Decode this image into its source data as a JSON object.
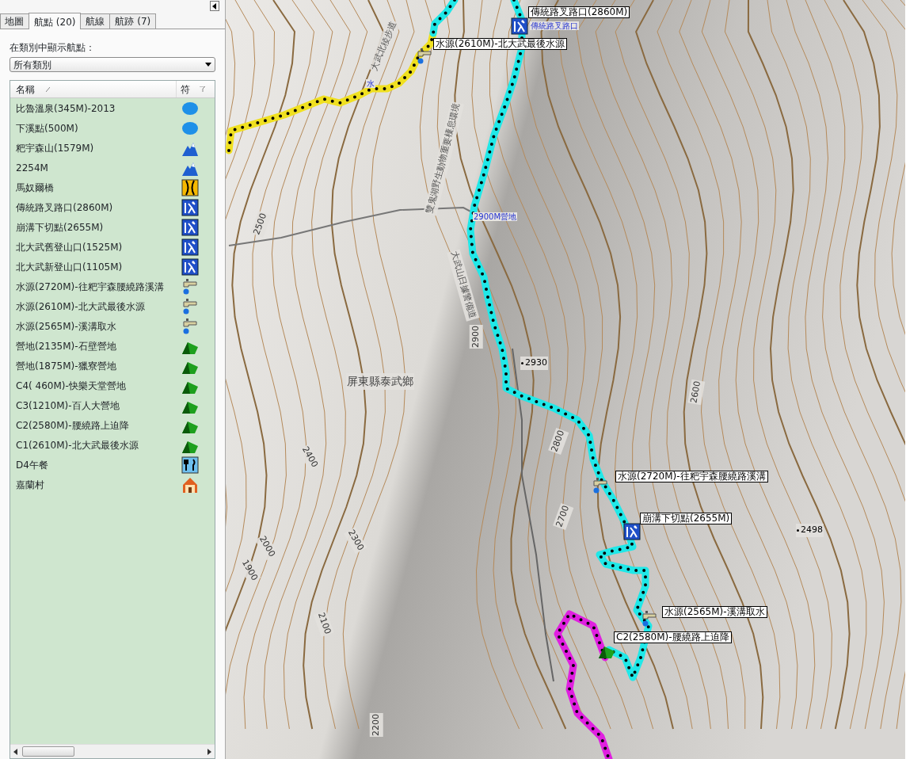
{
  "tabs": [
    {
      "label": "地圖",
      "selected": false
    },
    {
      "label": "航點 (20)",
      "selected": true
    },
    {
      "label": "航線",
      "selected": false
    },
    {
      "label": "航跡 (7)",
      "selected": false
    }
  ],
  "category_filter": {
    "label": "在類別中顯示航點：",
    "value": "所有類別"
  },
  "waypoint_list": {
    "columns": [
      "名稱",
      "符"
    ],
    "rows": [
      {
        "name": "比魯溫泉(345M)-2013",
        "kind": "hotspring"
      },
      {
        "name": "下溪點(500M)",
        "kind": "hotspring"
      },
      {
        "name": "粑宇森山(1579M)",
        "kind": "summit"
      },
      {
        "name": "2254M",
        "kind": "summit"
      },
      {
        "name": "馬奴爾橋",
        "kind": "bridge"
      },
      {
        "name": "傳統路叉路口(2860M)",
        "kind": "trailhead"
      },
      {
        "name": "崩溝下切點(2655M)",
        "kind": "trailhead"
      },
      {
        "name": "北大武舊登山口(1525M)",
        "kind": "trailhead"
      },
      {
        "name": "北大武新登山口(1105M)",
        "kind": "trailhead"
      },
      {
        "name": "水源(2720M)-往粑宇森腰繞路溪溝",
        "kind": "water"
      },
      {
        "name": "水源(2610M)-北大武最後水源",
        "kind": "water"
      },
      {
        "name": "水源(2565M)-溪溝取水",
        "kind": "water"
      },
      {
        "name": "營地(2135M)-石壁營地",
        "kind": "camp"
      },
      {
        "name": "營地(1875M)-獵寮營地",
        "kind": "camp"
      },
      {
        "name": "C4( 460M)-快樂天堂營地",
        "kind": "camp"
      },
      {
        "name": "C3(1210M)-百人大營地",
        "kind": "camp"
      },
      {
        "name": "C2(2580M)-腰繞路上迫降",
        "kind": "camp"
      },
      {
        "name": "C1(2610M)-北大武最後水源",
        "kind": "camp"
      },
      {
        "name": "D4午餐",
        "kind": "food"
      },
      {
        "name": "嘉蘭村",
        "kind": "house"
      }
    ]
  },
  "map": {
    "waypoint_labels": [
      {
        "text": "傳統路叉路口(2860M)",
        "kind": "trailhead"
      },
      {
        "text": "水源(2610M)-北大武最後水源",
        "kind": "water"
      },
      {
        "text": "水源(2720M)-往粑宇森腰繞路溪溝",
        "kind": "water"
      },
      {
        "text": "崩溝下切點(2655M)",
        "kind": "trailhead"
      },
      {
        "text": "水源(2565M)-溪溝取水",
        "kind": "water"
      },
      {
        "text": "C2(2580M)-腰繞路上迫降",
        "kind": "camp"
      }
    ],
    "map_notes": [
      "傳統路叉路口",
      "2900M營地",
      "水"
    ],
    "area_label": "屏東縣泰武鄉",
    "trail_names": [
      "大武北稜步道",
      "雙鬼湖野生動物重要棲息環境",
      "大武山日據警備道"
    ],
    "spot_heights": [
      "2930",
      "2498"
    ],
    "contour_labels": [
      "2500",
      "2900",
      "2800",
      "2700",
      "2600",
      "2400",
      "2300",
      "2000",
      "1900",
      "2100",
      "2200"
    ]
  }
}
